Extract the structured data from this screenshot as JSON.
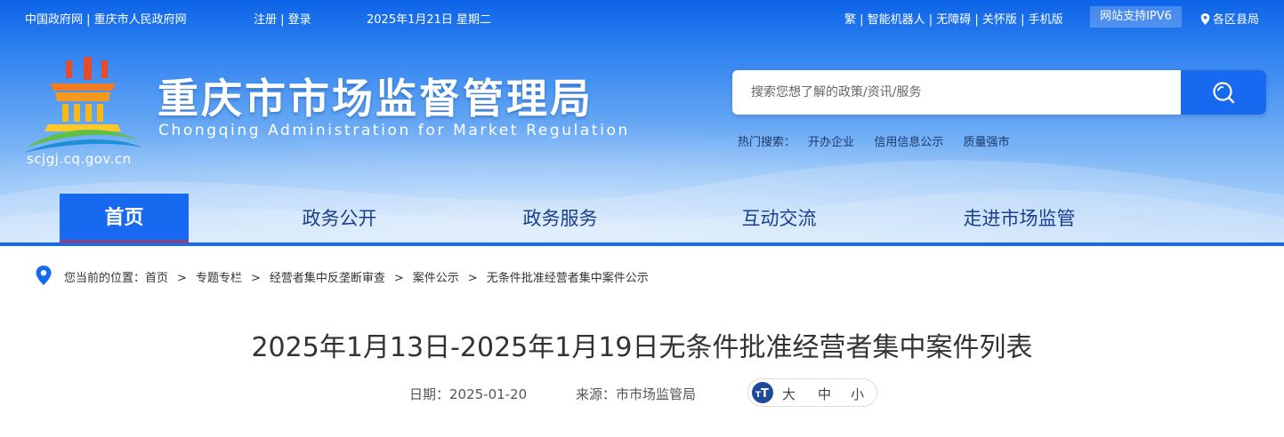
{
  "topbar": {
    "gov_links": "中国政府网 | 重庆市人民政府网",
    "auth": "注册 | 登录",
    "date": "2025年1月21日 星期二",
    "right_links": "繁 | 智能机器人 | 无障碍 | 关怀版 | 手机版",
    "ipv6": "网站支持IPV6",
    "region": "各区县局"
  },
  "site": {
    "title": "重庆市市场监督管理局",
    "subtitle": "Chongqing Administration for Market Regulation",
    "domain": "scjgj.cq.gov.cn"
  },
  "search": {
    "placeholder": "搜索您想了解的政策/资讯/服务",
    "hot_label": "热门搜索：",
    "hot": [
      "开办企业",
      "信用信息公示",
      "质量强市"
    ]
  },
  "nav": [
    "首页",
    "政务公开",
    "政务服务",
    "互动交流",
    "走进市场监管"
  ],
  "breadcrumb": {
    "label": "您当前的位置：",
    "items": [
      "首页",
      "专题专栏",
      "经营者集中反垄断审查",
      "案件公示",
      "无条件批准经营者集中案件公示"
    ]
  },
  "article": {
    "title": "2025年1月13日-2025年1月19日无条件批准经营者集中案件列表",
    "date": "日期：2025-01-20",
    "source": "来源：市市场监管局",
    "font_sizes": [
      "大",
      "中",
      "小"
    ]
  },
  "colors": {
    "primary": "#1769f0",
    "nav_active_underline": "#e0262b",
    "nav_text": "#1a3f8c"
  }
}
